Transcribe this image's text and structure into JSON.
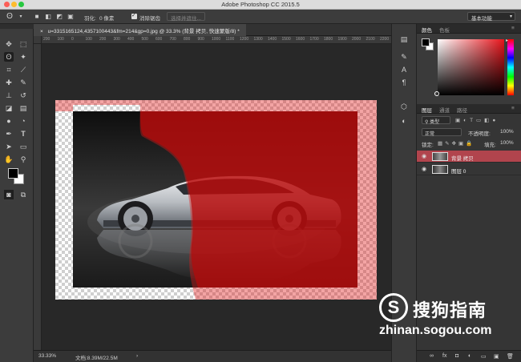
{
  "window": {
    "title": "Adobe Photoshop CC 2015.5"
  },
  "options_bar": {
    "feather_label": "羽化:",
    "feather_value": "0 像素",
    "antialias_label": "消除锯齿",
    "select_mask_button": "选择并遮住...",
    "workspace": "基本功能"
  },
  "document": {
    "tab_title": "u=3315165124,4357100443&fm=214&gp=0.jpg @ 33.3% (背景 拷贝, 快速蒙版/8) *",
    "ruler_ticks": [
      "200",
      "100",
      "0",
      "100",
      "200",
      "300",
      "400",
      "500",
      "600",
      "700",
      "800",
      "900",
      "1000",
      "1100",
      "1200",
      "1300",
      "1400",
      "1500",
      "1600",
      "1700",
      "1800",
      "1900",
      "2000",
      "2100",
      "2200"
    ],
    "status_zoom": "33.33%",
    "status_doc": "文档:8.39M/22.5M",
    "status_arrow": "›",
    "quick_mask_color": "#e11b1b",
    "car_colors": [
      "#d8dadd",
      "#2b2e33",
      "#5a5f66"
    ]
  },
  "tools": [
    {
      "icon": "move-tool-icon",
      "glyph": "✥"
    },
    {
      "icon": "marquee-tool-icon",
      "glyph": "⬚"
    },
    {
      "icon": "lasso-tool-icon",
      "glyph": "ʘ"
    },
    {
      "icon": "magic-wand-tool-icon",
      "glyph": "✦"
    },
    {
      "icon": "crop-tool-icon",
      "glyph": "⌗"
    },
    {
      "icon": "eyedropper-tool-icon",
      "glyph": "⟋"
    },
    {
      "icon": "healing-brush-tool-icon",
      "glyph": "✚"
    },
    {
      "icon": "brush-tool-icon",
      "glyph": "✎"
    },
    {
      "icon": "stamp-tool-icon",
      "glyph": "⊥"
    },
    {
      "icon": "history-brush-tool-icon",
      "glyph": "↺"
    },
    {
      "icon": "eraser-tool-icon",
      "glyph": "◪"
    },
    {
      "icon": "gradient-tool-icon",
      "glyph": "▤"
    },
    {
      "icon": "blur-tool-icon",
      "glyph": "●"
    },
    {
      "icon": "dodge-tool-icon",
      "glyph": "◔"
    },
    {
      "icon": "pen-tool-icon",
      "glyph": "✒"
    },
    {
      "icon": "type-tool-icon",
      "glyph": "T"
    },
    {
      "icon": "path-selection-tool-icon",
      "glyph": "➤"
    },
    {
      "icon": "rectangle-tool-icon",
      "glyph": "▭"
    },
    {
      "icon": "hand-tool-icon",
      "glyph": "✋"
    },
    {
      "icon": "zoom-tool-icon",
      "glyph": "⚲"
    },
    {
      "icon": "more-tools-icon",
      "glyph": "···"
    }
  ],
  "panels": {
    "color_tabs": [
      "颜色",
      "色板"
    ],
    "layers_tabs": [
      "图层",
      "通道",
      "路径"
    ],
    "filter_kind": "类型",
    "blend_mode": "正常",
    "opacity_label": "不透明度:",
    "opacity_value": "100%",
    "lock_label": "锁定:",
    "fill_label": "填充:",
    "fill_value": "100%",
    "layers": [
      {
        "name": "背景 拷贝",
        "selected": true
      },
      {
        "name": "图层 0",
        "selected": false
      }
    ],
    "footer_icons": [
      "link-icon",
      "fx-icon",
      "mask-icon",
      "adjustment-icon",
      "folder-icon",
      "new-layer-icon",
      "trash-icon"
    ],
    "footer_glyphs": [
      "∞",
      "fx",
      "◘",
      "◐",
      "▭",
      "▣",
      "🗑"
    ]
  },
  "watermark": {
    "logo": "S",
    "title": "搜狗指南",
    "url": "zhinan.sogou.com"
  }
}
